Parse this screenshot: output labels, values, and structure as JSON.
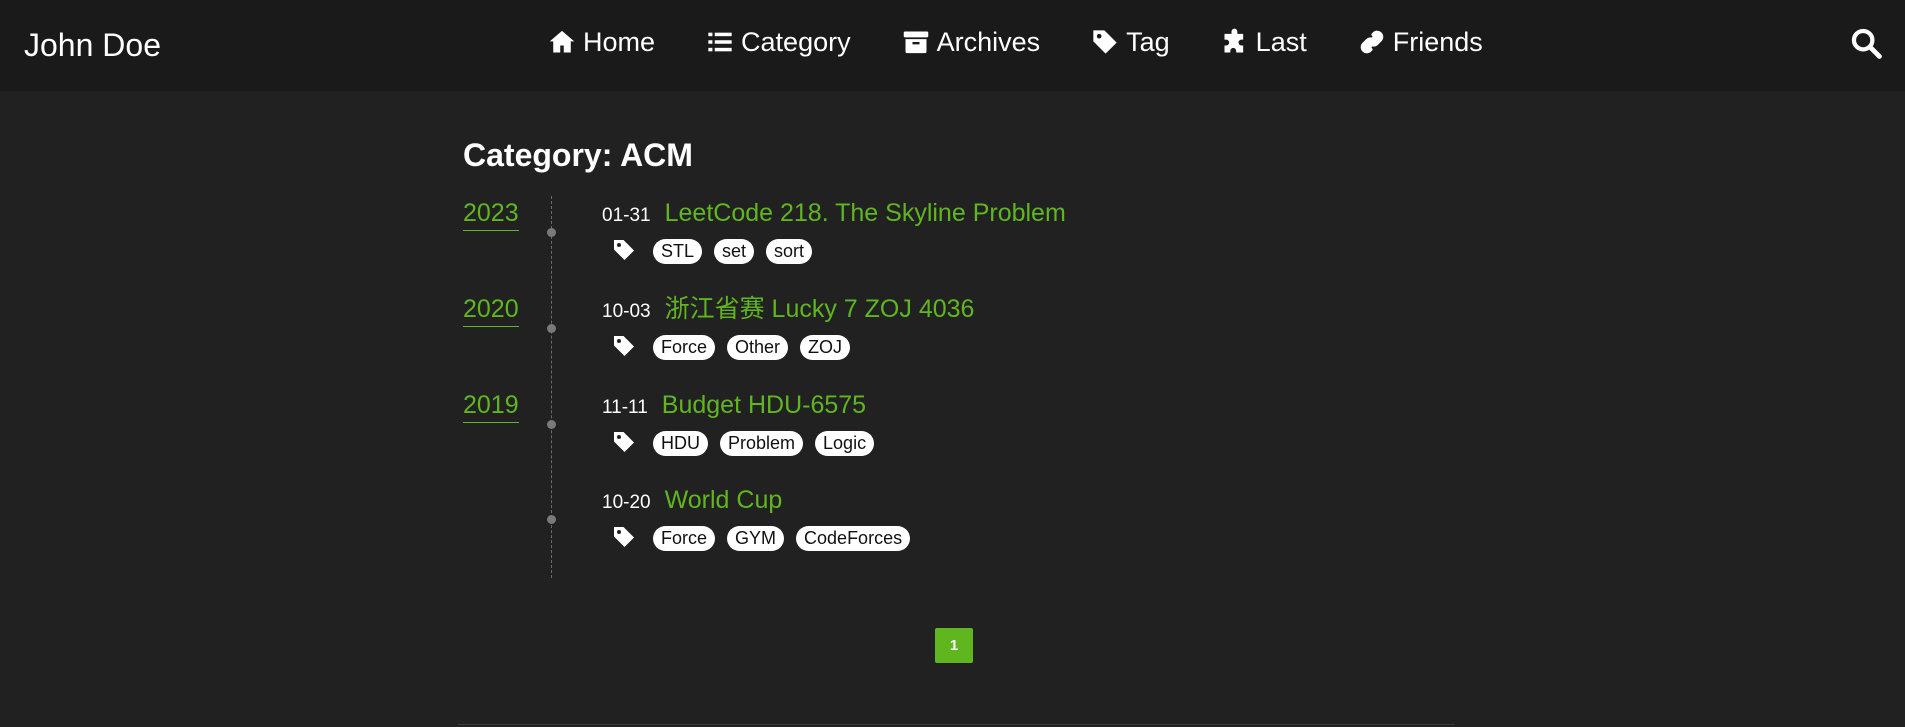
{
  "brand": "John Doe",
  "nav": [
    {
      "label": "Home",
      "icon": "home-icon"
    },
    {
      "label": "Category",
      "icon": "list-icon"
    },
    {
      "label": "Archives",
      "icon": "archive-icon"
    },
    {
      "label": "Tag",
      "icon": "tag-icon"
    },
    {
      "label": "Last",
      "icon": "puzzle-icon"
    },
    {
      "label": "Friends",
      "icon": "link-icon"
    }
  ],
  "search_icon": "search-icon",
  "page_title": "Category: ACM",
  "years": [
    "2023",
    "2020",
    "2019"
  ],
  "posts": [
    {
      "date": "01-31",
      "title": "LeetCode 218. The Skyline Problem",
      "tags": [
        "STL",
        "set",
        "sort"
      ]
    },
    {
      "date": "10-03",
      "title": "浙江省赛 Lucky 7 ZOJ 4036",
      "tags": [
        "Force",
        "Other",
        "ZOJ"
      ]
    },
    {
      "date": "11-11",
      "title": "Budget HDU-6575",
      "tags": [
        "HDU",
        "Problem",
        "Logic"
      ]
    },
    {
      "date": "10-20",
      "title": "World Cup",
      "tags": [
        "Force",
        "GYM",
        "CodeForces"
      ]
    }
  ],
  "pagination": {
    "current": "1"
  },
  "colors": {
    "background": "#212121",
    "header": "#1a1a1a",
    "accent": "#5fb61f",
    "text": "#ffffff"
  }
}
